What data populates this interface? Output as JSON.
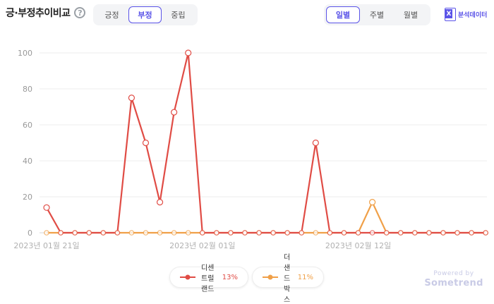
{
  "header": {
    "title": "긍·부정추이비교",
    "help_symbol": "?",
    "sentiment_tabs": [
      {
        "label": "긍정",
        "active": false
      },
      {
        "label": "부정",
        "active": true
      },
      {
        "label": "중립",
        "active": false
      }
    ],
    "period_tabs": [
      {
        "label": "일별",
        "active": true
      },
      {
        "label": "주별",
        "active": false
      },
      {
        "label": "월별",
        "active": false
      }
    ],
    "export_label": "분석데이터",
    "export_icon_letter": "X"
  },
  "chart_data": {
    "type": "line",
    "categories": [
      "2023-01-21",
      "2023-01-22",
      "2023-01-23",
      "2023-01-24",
      "2023-01-25",
      "2023-01-26",
      "2023-01-27",
      "2023-01-28",
      "2023-01-29",
      "2023-01-30",
      "2023-01-31",
      "2023-02-01",
      "2023-02-02",
      "2023-02-03",
      "2023-02-04",
      "2023-02-05",
      "2023-02-06",
      "2023-02-07",
      "2023-02-08",
      "2023-02-09",
      "2023-02-10",
      "2023-02-11",
      "2023-02-12",
      "2023-02-13",
      "2023-02-14",
      "2023-02-15",
      "2023-02-16",
      "2023-02-17",
      "2023-02-18",
      "2023-02-19",
      "2023-02-20",
      "2023-02-21"
    ],
    "x_tick_labels": [
      {
        "index": 0,
        "label": "2023년 01월 21일"
      },
      {
        "index": 11,
        "label": "2023년 02월 01일"
      },
      {
        "index": 22,
        "label": "2023년 02월 12일"
      }
    ],
    "y_ticks": [
      0,
      20,
      40,
      60,
      80,
      100
    ],
    "ylim": [
      0,
      100
    ],
    "grid": true,
    "series": [
      {
        "name": "디센트럴랜드",
        "percent": "13%",
        "color": "#e04c45",
        "values": [
          14,
          0,
          0,
          0,
          0,
          0,
          75,
          50,
          17,
          67,
          100,
          0,
          0,
          0,
          0,
          0,
          0,
          0,
          0,
          50,
          0,
          0,
          0,
          0,
          0,
          0,
          0,
          0,
          0,
          0,
          0,
          0
        ]
      },
      {
        "name": "더샌드박스",
        "percent": "11%",
        "color": "#f0a048",
        "values": [
          0,
          0,
          0,
          0,
          0,
          0,
          0,
          0,
          0,
          0,
          0,
          0,
          0,
          0,
          0,
          0,
          0,
          0,
          0,
          0,
          0,
          0,
          0,
          17,
          0,
          0,
          0,
          0,
          0,
          0,
          0,
          0
        ]
      }
    ]
  },
  "branding": {
    "powered_by": "Powered by",
    "name": "Sometrend"
  }
}
